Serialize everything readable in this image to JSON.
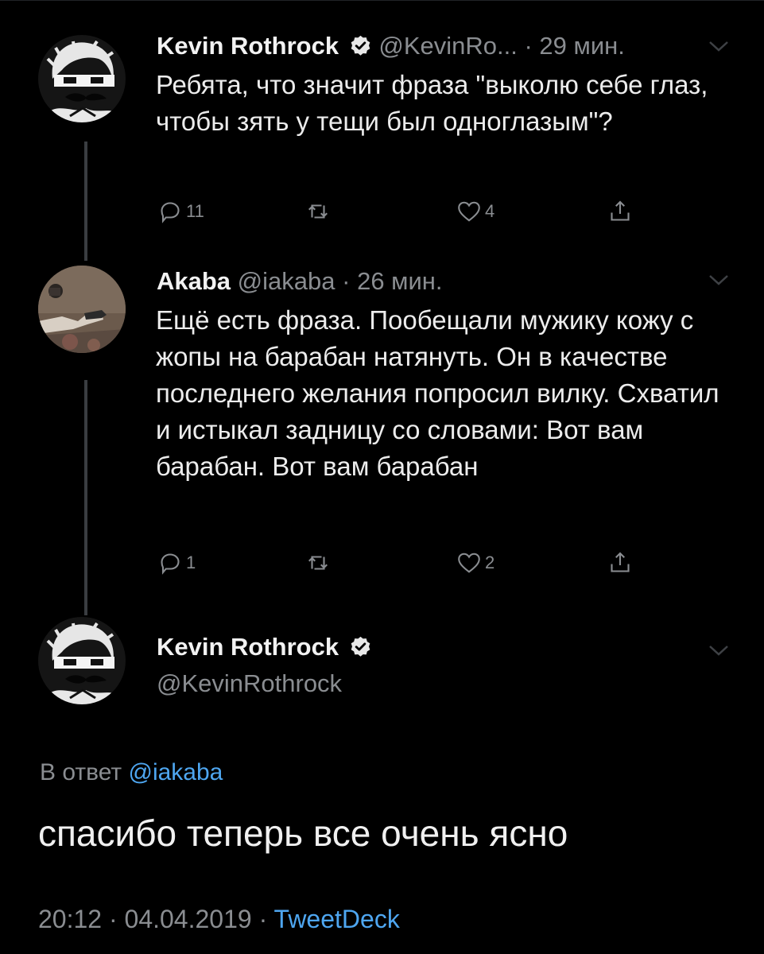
{
  "colors": {
    "background": "#000000",
    "text": "#ececec",
    "secondary": "#8a8d91",
    "link": "#4ea6f0",
    "thread_line": "#3a3d41"
  },
  "tweets": [
    {
      "name": "Kevin Rothrock",
      "verified": true,
      "handle": "@KevinRo...",
      "separator": "·",
      "time": "29 мин.",
      "text": "Ребята, что значит фраза \"выколю себе глаз, чтобы зять у тещи был одноглазым\"?",
      "reply_count": "11",
      "retweet_count": "",
      "like_count": "4",
      "icons": [
        "reply-icon",
        "retweet-icon",
        "like-icon",
        "share-icon"
      ]
    },
    {
      "name": "Akaba",
      "verified": false,
      "handle": "@iakaba",
      "separator": "·",
      "time": "26 мин.",
      "text": "Ещё есть фраза. Пообещали мужику кожу с жопы на барабан натянуть. Он в качестве последнего желания попросил вилку. Схватил и истыкал задницу со словами: Вот вам барабан. Вот вам барабан",
      "reply_count": "1",
      "retweet_count": "",
      "like_count": "2",
      "icons": [
        "reply-icon",
        "retweet-icon",
        "like-icon",
        "share-icon"
      ]
    }
  ],
  "main_tweet": {
    "name": "Kevin Rothrock",
    "verified": true,
    "handle": "@KevinRothrock",
    "reply_prefix": "В ответ",
    "reply_to": "@iakaba",
    "text": "спасибо теперь все очень ясно",
    "time": "20:12",
    "separator": "·",
    "date": "04.04.2019",
    "source": "TweetDeck"
  }
}
